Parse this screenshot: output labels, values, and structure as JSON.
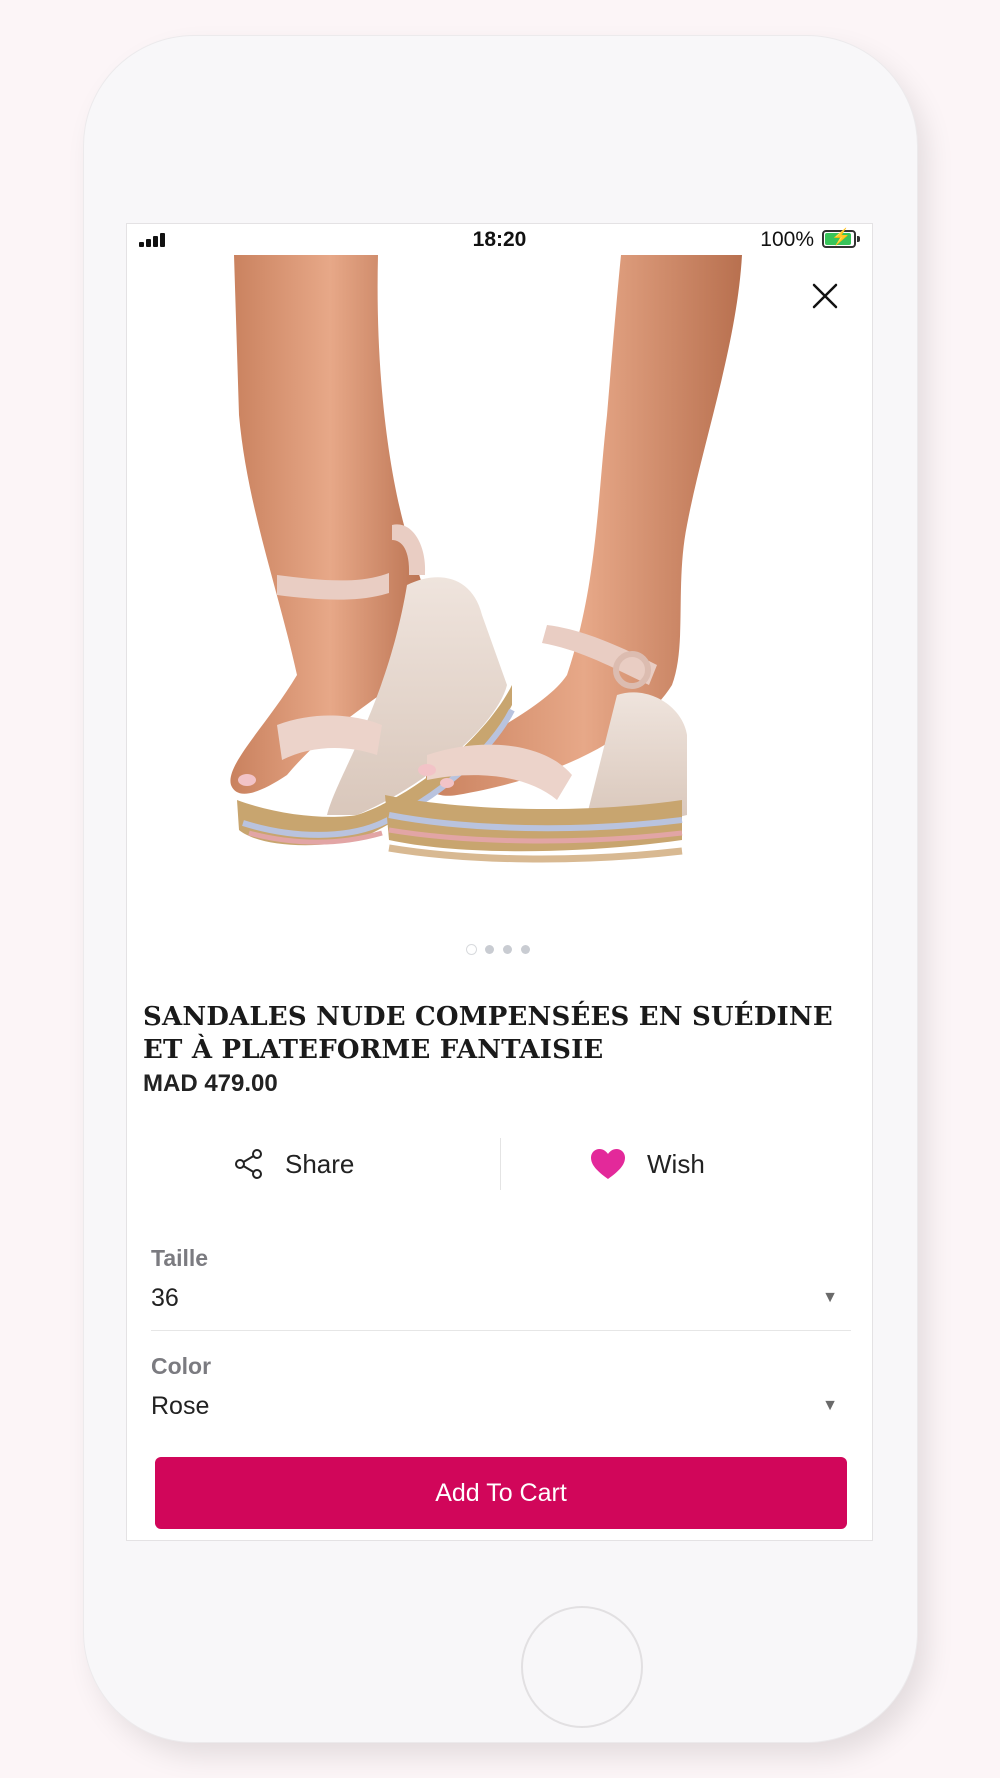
{
  "status_bar": {
    "time": "18:20",
    "battery": "100%"
  },
  "gallery": {
    "image_count": 4,
    "active_index": 0
  },
  "product": {
    "title": "SANDALES NUDE COMPENSÉES EN SUÉDINE ET À PLATEFORME FANTAISIE",
    "price": "MAD 479.00"
  },
  "actions": {
    "share_label": "Share",
    "wish_label": "Wish"
  },
  "options": {
    "size": {
      "label": "Taille",
      "value": "36"
    },
    "color": {
      "label": "Color",
      "value": "Rose"
    }
  },
  "cart": {
    "label": "Add To Cart"
  },
  "colors": {
    "accent": "#d1065a",
    "wish_heart": "#e3299a",
    "background": "#fcf5f7"
  }
}
